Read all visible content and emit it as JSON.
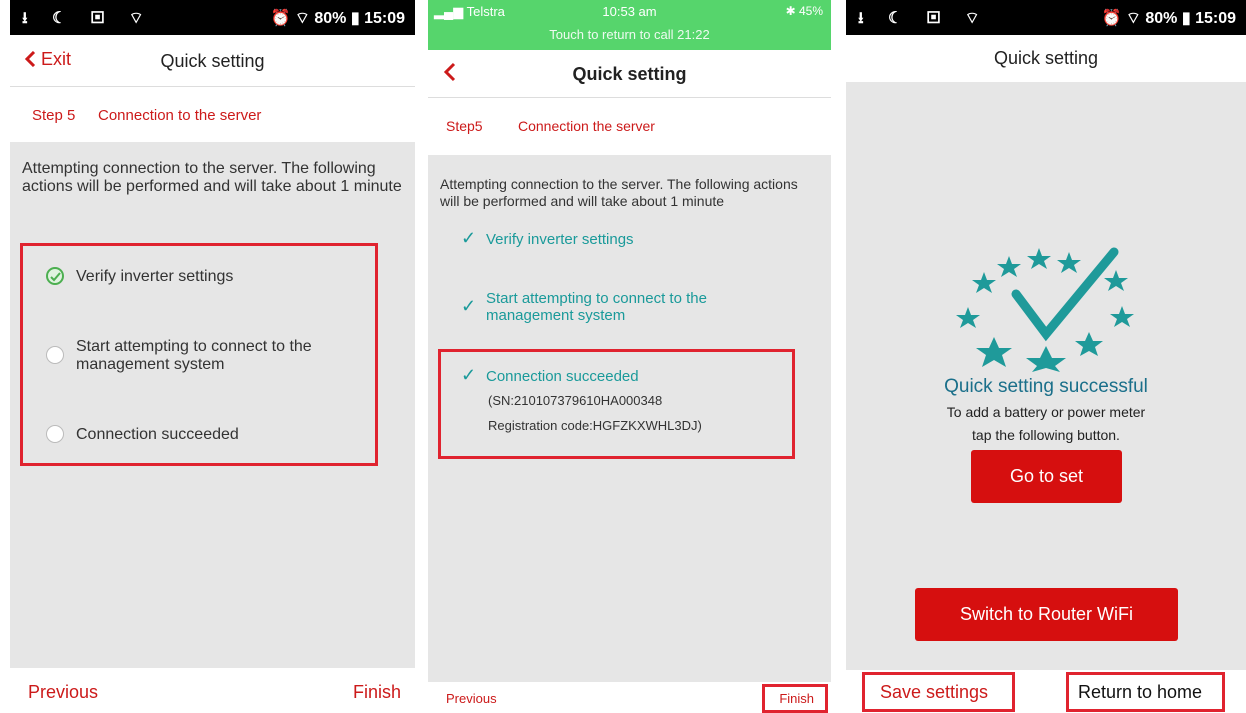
{
  "panel1": {
    "status": {
      "left_icons": "⭳ ☾ ▣ ⌔",
      "right": "⏰ ⌔ 80% ▮ 15:09"
    },
    "header": {
      "back_label": "Exit",
      "title": "Quick setting"
    },
    "step": {
      "number": "Step 5",
      "name": "Connection to the server"
    },
    "description": "Attempting connection to the server. The following actions will be performed and will take about 1 minute",
    "items": [
      {
        "label": "Verify inverter settings",
        "status": "done"
      },
      {
        "label": "Start attempting to connect to the management system",
        "status": "pending"
      },
      {
        "label": "Connection succeeded",
        "status": "pending"
      }
    ],
    "footer": {
      "previous": "Previous",
      "finish": "Finish"
    }
  },
  "panel2": {
    "status": {
      "carrier": "Telstra",
      "time": "10:53 am",
      "battery": "45%",
      "call": "Touch to return to call 21:22"
    },
    "header": {
      "title": "Quick setting"
    },
    "step": {
      "number": "Step5",
      "name": "Connection the server"
    },
    "description": "Attempting connection to the server. The following actions will be performed and will take about 1 minute",
    "items": [
      {
        "label": "Verify inverter settings"
      },
      {
        "label": "Start attempting to connect to the management system"
      },
      {
        "label": "Connection succeeded"
      }
    ],
    "sn": "(SN:210107379610HA000348",
    "registration": "Registration code:HGFZKXWHL3DJ)",
    "footer": {
      "previous": "Previous",
      "finish": "Finish"
    }
  },
  "panel3": {
    "status": {
      "left_icons": "⭳ ☾ ▣ ⌔",
      "right": "⏰ ⌔ 80% ▮ 15:09"
    },
    "header": {
      "title": "Quick setting"
    },
    "success_title": "Quick setting successful",
    "success_line1": "To add a battery or power meter",
    "success_line2": "tap the following button.",
    "go_to_set": "Go to set",
    "switch_wifi": "Switch to Router WiFi",
    "save_settings": "Save settings",
    "return_home": "Return to home"
  },
  "colors": {
    "accent": "#cc1a1a",
    "highlight": "#e0232f",
    "success": "#1a9a9a",
    "status_green": "#56d56c"
  }
}
